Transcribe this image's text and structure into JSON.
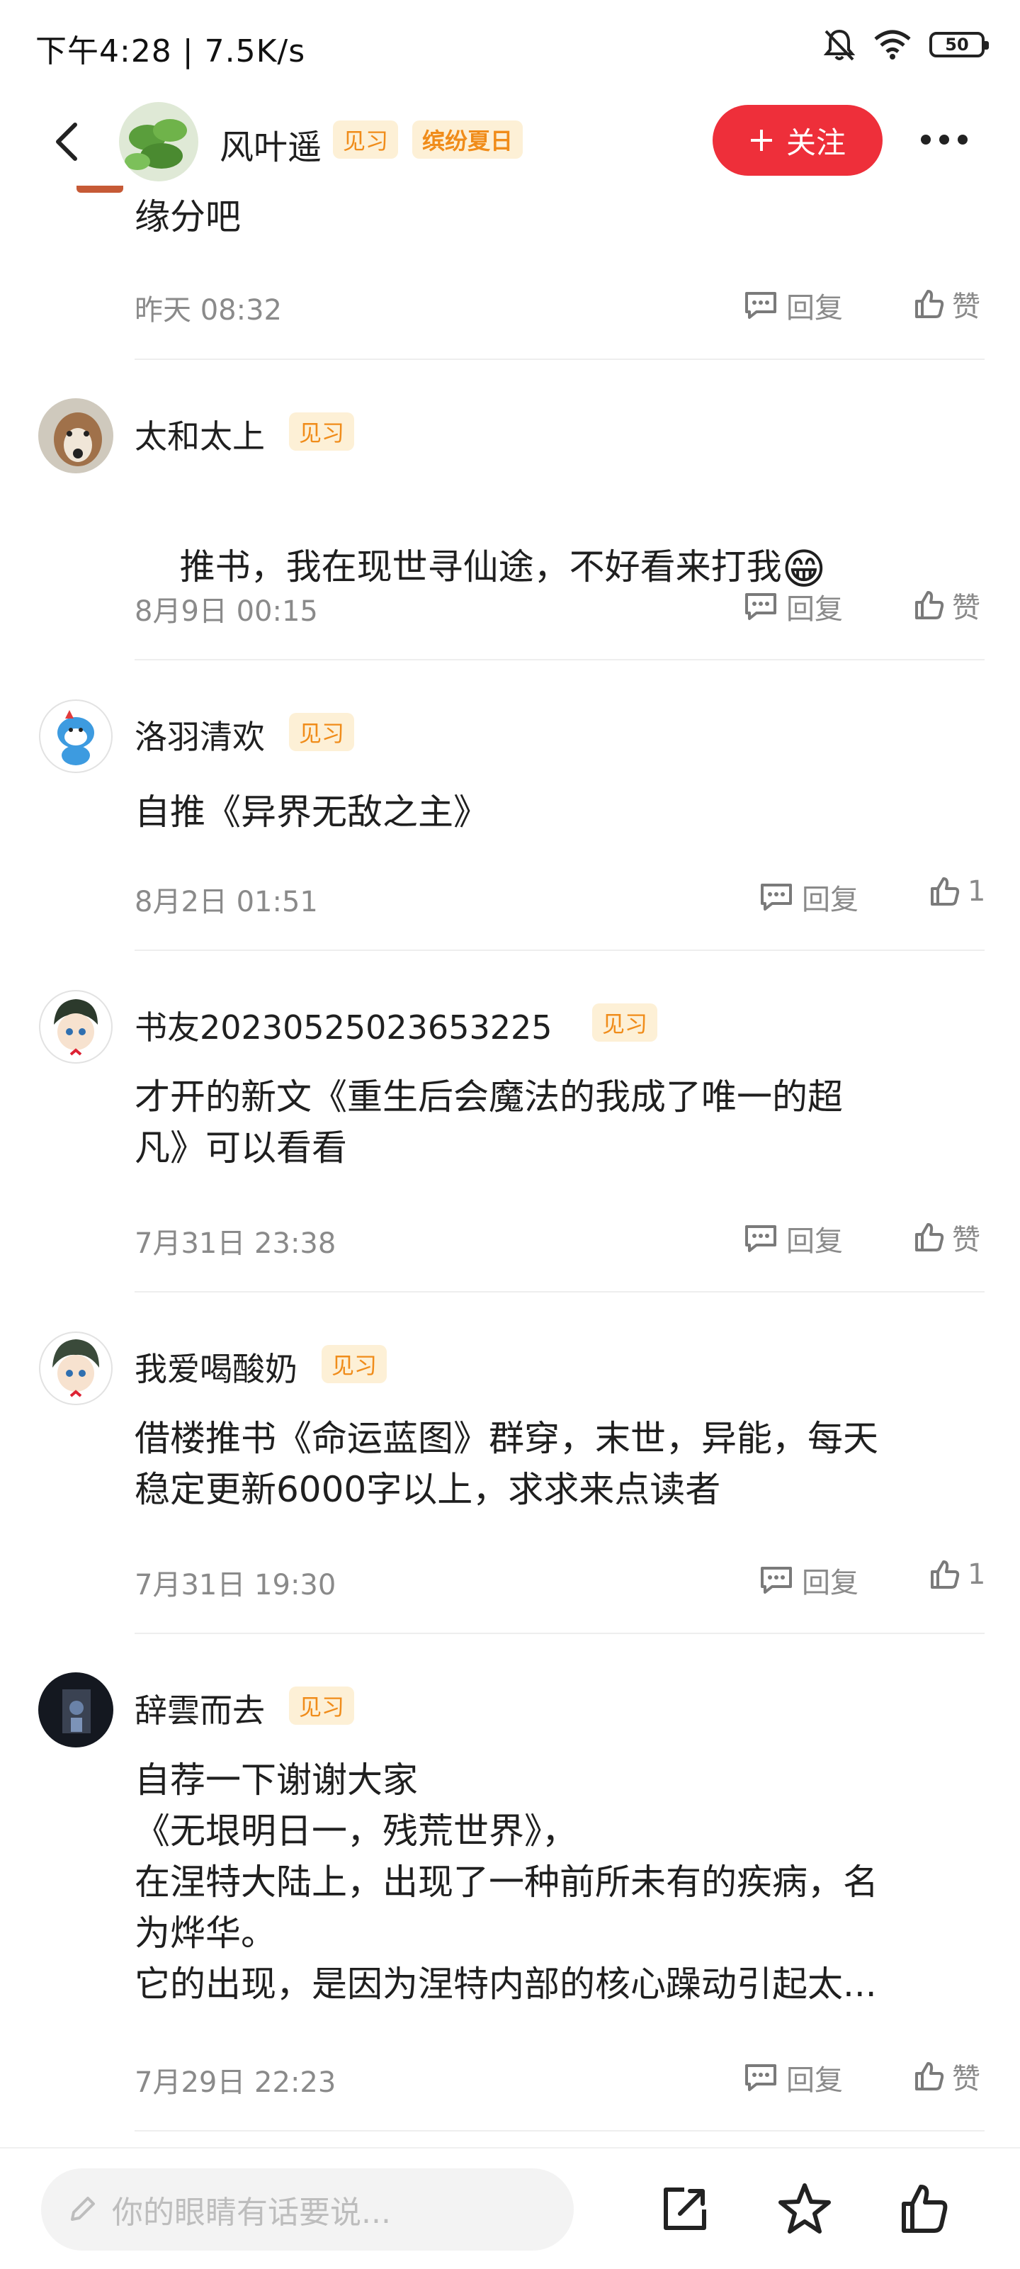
{
  "status_bar": {
    "left_text": "下午4:28 | 7.5K/s",
    "battery": "50"
  },
  "header": {
    "author_name": "风叶遥",
    "tag1": "见习",
    "tag2": "缤纷夏日",
    "follow_label": "关注"
  },
  "partial_comment": {
    "text": "缘分吧",
    "time": "昨天 08:32",
    "reply_label": "回复",
    "like_label": "赞"
  },
  "comments": [
    {
      "name": "太和太上",
      "tag": "见习",
      "text": "推书，我在现世寻仙途，不好看来打我",
      "emoji": "😁",
      "time": "8月9日 00:15",
      "reply_label": "回复",
      "like_label": "赞"
    },
    {
      "name": "洛羽清欢",
      "tag": "见习",
      "text": "自推《异界无敌之主》",
      "time": "8月2日 01:51",
      "reply_label": "回复",
      "like_label": "1"
    },
    {
      "name": "书友20230525023653225",
      "tag": "见习",
      "text": "才开的新文《重生后会魔法的我成了唯一的超\n凡》可以看看",
      "time": "7月31日 23:38",
      "reply_label": "回复",
      "like_label": "赞"
    },
    {
      "name": "我爱喝酸奶",
      "tag": "见习",
      "text": "借楼推书《命运蓝图》群穿，末世，异能，每天\n稳定更新6000字以上，求求来点读者",
      "time": "7月31日 19:30",
      "reply_label": "回复",
      "like_label": "1"
    },
    {
      "name": "辞雲而去",
      "tag": "见习",
      "text": "自荐一下谢谢大家\n《无垠明日一，残荒世界》，\n在涅特大陆上，出现了一种前所未有的疾病，名\n为烨华。\n它的出现，是因为涅特内部的核心躁动引起太...",
      "time": "7月29日 22:23",
      "reply_label": "回复",
      "like_label": "赞"
    }
  ],
  "bottom_bar": {
    "input_placeholder": "你的眼睛有话要说..."
  }
}
